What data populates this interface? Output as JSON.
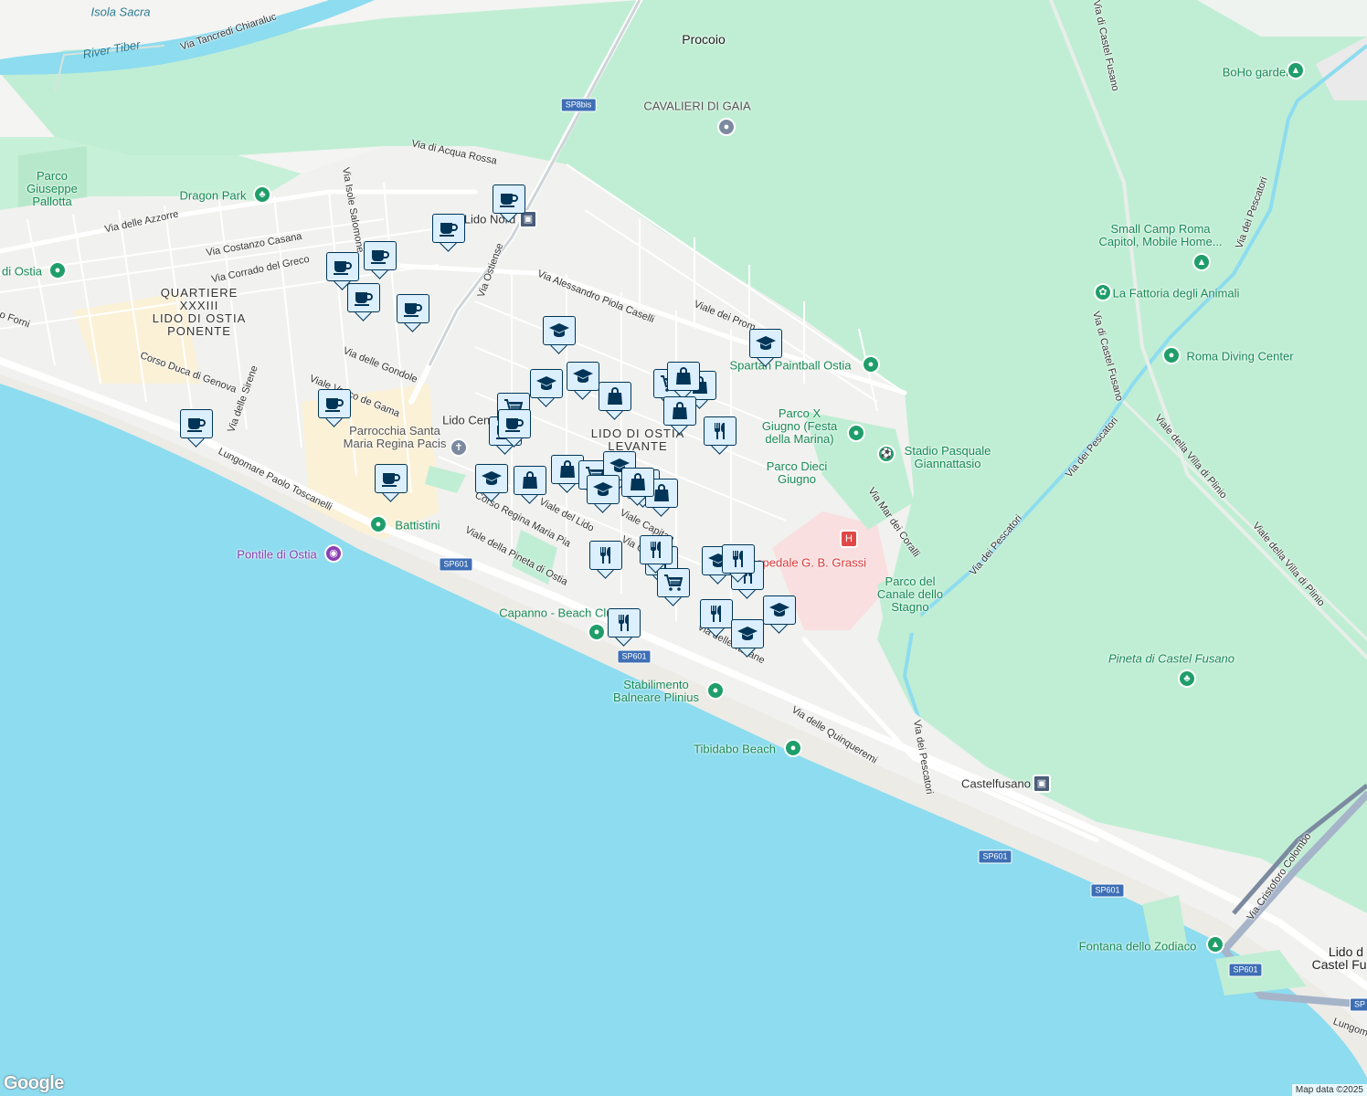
{
  "map": {
    "attribution": "Map data ©2025",
    "logo": "Google",
    "colors": {
      "sea": "#8ddcef",
      "land": "#f4f4f2",
      "green": "#c0eed4",
      "road": "#ffffff",
      "marker_fill": "#dcefff",
      "marker_icon": "#003557",
      "poi_green": "#1f9e6a"
    },
    "labels": {
      "isola_sacra": "Isola Sacra",
      "river_tiber": "River Tiber",
      "procoio": "Procoio",
      "via_tancredi": "Via Tancredi Chiaraluc",
      "via_castel_fusano_top": "Via di Castel Fusano",
      "boho_garden": "BoHo garden",
      "cavalieri": "CAVALIERI DI GAIA",
      "via_acqua_rossa": "Via di Acqua Rossa",
      "parco_pallotta": "Parco\nGiuseppe\nPallotta",
      "dragon_park": "Dragon Park",
      "via_azzorre": "Via delle Azzorre",
      "via_isole_salomone": "Via Isole Salomone",
      "lido_nord": "Lido Nord",
      "via_ostiense": "Via Ostiense",
      "via_costanzo": "Via Costanzo Casana",
      "via_corrado": "Via Corrado del Greco",
      "di_ostia": "di Ostia",
      "quartiere": "QUARTIERE\nXXXIII\nLIDO DI OSTIA\nPONENTE",
      "via_forni": "o Forni",
      "via_piola": "Via Alessandro Piola Caselli",
      "viale_promontori": "Viale dei Prom",
      "small_camp": "Small Camp Roma\nCapitol, Mobile Home...",
      "fattoria": "La Fattoria degli Animali",
      "via_pescatori_ne": "Via dei Pescatori",
      "via_castel_fusano_mid": "Via di Castel Fusano",
      "roma_diving": "Roma Diving Center",
      "spartan": "Spartan Paintball Ostia",
      "via_gondole": "Via delle Gondole",
      "corso_genova": "Corso Duca di Genova",
      "viale_vasco": "Viale Vasco de Gama",
      "via_sirene": "Via delle Sirene",
      "lido_centro": "Lido Cent",
      "parrocchia": "Parrocchia Santa\nMaria Regina Pacis",
      "lido_levante": "LIDO DI OSTIA\nLEVANTE",
      "parco_x": "Parco X\nGiugno (Festa\ndella Marina)",
      "stadio": "Stadio Pasquale\nGiannattasio",
      "parco_dieci": "Parco Dieci\nGiugno",
      "viale_villa_plinio_1": "Viale della Villa di Plinio",
      "viale_villa_plinio_2": "Viale della Villa di Plinio",
      "via_pescatori_mid": "Via dei Pescatori",
      "lungomare": "Lungomare Paolo Toscanelli",
      "corso_regina": "Corso Regina Maria Pia",
      "viale_lido": "Viale del Lido",
      "viale_capitan": "Viale Capitan",
      "via_mar_coralli": "Via Mar dei Coralli",
      "battistini": "Battistini",
      "pontile": "Pontile di Ostia",
      "viale_pineta": "Viale della Pineta di Ostia",
      "ospedale": "spedale G. B. Grassi",
      "parco_canale": "Parco del\nCanale dello\nStagno",
      "via_ol": "Via Ol",
      "capanno": "Capanno - Beach Club",
      "via_tartane": "Via delle Tartane",
      "pineta_castel_fusano": "Pineta di Castel Fusano",
      "stabilimento": "Stabilimento\nBalneare Plinius",
      "via_quinqueremi": "Via delle Quinqueremi",
      "tibidabo": "Tibidabo Beach",
      "via_pescatori_s": "Via dei Pescatori",
      "castelfusano": "Castelfusano",
      "via_colombo": "Via Cristoforo Colombo",
      "lido_castel_fusano": "Lido d\nCastel Fusa",
      "fontana": "Fontana dello Zodiaco",
      "lungom": "Lungom"
    },
    "road_shields": [
      "SP8bis",
      "SP601",
      "SP601",
      "SP601",
      "SP601",
      "SP601",
      "SP601",
      "SP"
    ],
    "markers": [
      {
        "type": "coffee",
        "name": "coffee-marker"
      },
      {
        "type": "coffee",
        "name": "coffee-marker"
      },
      {
        "type": "coffee",
        "name": "coffee-marker"
      },
      {
        "type": "coffee",
        "name": "coffee-marker"
      },
      {
        "type": "coffee",
        "name": "coffee-marker"
      },
      {
        "type": "coffee",
        "name": "coffee-marker"
      },
      {
        "type": "coffee",
        "name": "coffee-marker"
      },
      {
        "type": "coffee",
        "name": "coffee-marker"
      },
      {
        "type": "coffee",
        "name": "coffee-marker"
      },
      {
        "type": "coffee",
        "name": "coffee-marker"
      },
      {
        "type": "school",
        "name": "school-marker"
      },
      {
        "type": "school",
        "name": "school-marker"
      },
      {
        "type": "shopping",
        "name": "shopping-marker"
      },
      {
        "type": "shopping",
        "name": "shopping-marker"
      },
      {
        "type": "cart",
        "name": "cart-marker"
      },
      {
        "type": "school",
        "name": "school-marker"
      },
      {
        "type": "shopping",
        "name": "shopping-marker"
      },
      {
        "type": "cart",
        "name": "cart-marker"
      },
      {
        "type": "shopping",
        "name": "shopping-marker"
      },
      {
        "type": "shopping",
        "name": "shopping-marker"
      },
      {
        "type": "restaurant",
        "name": "restaurant-marker"
      },
      {
        "type": "coffee",
        "name": "coffee-marker"
      },
      {
        "type": "school",
        "name": "school-marker"
      },
      {
        "type": "shopping",
        "name": "shopping-marker"
      },
      {
        "type": "shopping",
        "name": "shopping-marker"
      },
      {
        "type": "cart",
        "name": "cart-marker"
      },
      {
        "type": "school",
        "name": "school-marker"
      },
      {
        "type": "school",
        "name": "school-marker"
      },
      {
        "type": "shopping",
        "name": "shopping-marker"
      },
      {
        "type": "shopping",
        "name": "shopping-marker"
      },
      {
        "type": "restaurant",
        "name": "restaurant-marker"
      },
      {
        "type": "restaurant",
        "name": "restaurant-marker"
      },
      {
        "type": "cart",
        "name": "cart-marker"
      },
      {
        "type": "school",
        "name": "school-marker"
      },
      {
        "type": "restaurant",
        "name": "restaurant-marker"
      },
      {
        "type": "restaurant",
        "name": "restaurant-marker"
      },
      {
        "type": "school",
        "name": "school-marker"
      },
      {
        "type": "restaurant",
        "name": "restaurant-marker"
      },
      {
        "type": "school",
        "name": "school-marker"
      },
      {
        "type": "restaurant",
        "name": "restaurant-marker"
      },
      {
        "type": "school",
        "name": "school-marker"
      },
      {
        "type": "restaurant",
        "name": "restaurant-marker"
      }
    ]
  }
}
